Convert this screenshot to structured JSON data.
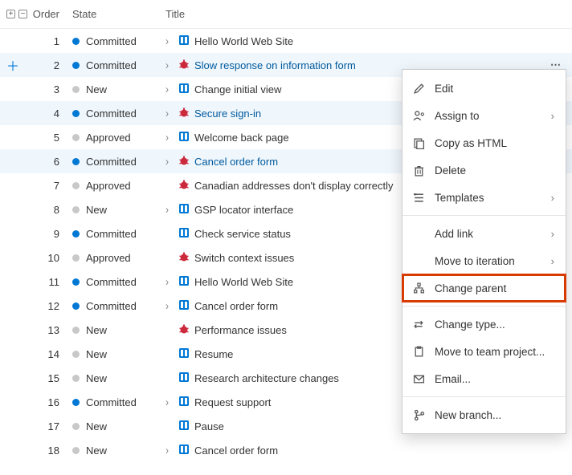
{
  "columns": {
    "order": "Order",
    "state": "State",
    "title": "Title"
  },
  "rows": [
    {
      "order": 1,
      "state": "Committed",
      "dot": "blue",
      "icon": "pbi",
      "chev": true,
      "link": false,
      "title": "Hello World Web Site",
      "sel": false,
      "actions": false,
      "add": false
    },
    {
      "order": 2,
      "state": "Committed",
      "dot": "blue",
      "icon": "bug",
      "chev": true,
      "link": true,
      "title": "Slow response on information form",
      "sel": true,
      "actions": true,
      "add": true
    },
    {
      "order": 3,
      "state": "New",
      "dot": "grey",
      "icon": "pbi",
      "chev": true,
      "link": false,
      "title": "Change initial view",
      "sel": false,
      "actions": false,
      "add": false
    },
    {
      "order": 4,
      "state": "Committed",
      "dot": "blue",
      "icon": "bug",
      "chev": true,
      "link": true,
      "title": "Secure sign-in",
      "sel": true,
      "actions": true,
      "add": false
    },
    {
      "order": 5,
      "state": "Approved",
      "dot": "grey",
      "icon": "pbi",
      "chev": true,
      "link": false,
      "title": "Welcome back page",
      "sel": false,
      "actions": false,
      "add": false
    },
    {
      "order": 6,
      "state": "Committed",
      "dot": "blue",
      "icon": "bug",
      "chev": true,
      "link": true,
      "title": "Cancel order form",
      "sel": true,
      "actions": true,
      "add": false
    },
    {
      "order": 7,
      "state": "Approved",
      "dot": "grey",
      "icon": "bug",
      "chev": false,
      "link": false,
      "title": "Canadian addresses don't display correctly",
      "sel": false,
      "actions": false,
      "add": false
    },
    {
      "order": 8,
      "state": "New",
      "dot": "grey",
      "icon": "pbi",
      "chev": true,
      "link": false,
      "title": "GSP locator interface",
      "sel": false,
      "actions": false,
      "add": false
    },
    {
      "order": 9,
      "state": "Committed",
      "dot": "blue",
      "icon": "pbi",
      "chev": false,
      "link": false,
      "title": "Check service status",
      "sel": false,
      "actions": false,
      "add": false
    },
    {
      "order": 10,
      "state": "Approved",
      "dot": "grey",
      "icon": "bug",
      "chev": false,
      "link": false,
      "title": "Switch context issues",
      "sel": false,
      "actions": false,
      "add": false
    },
    {
      "order": 11,
      "state": "Committed",
      "dot": "blue",
      "icon": "pbi",
      "chev": true,
      "link": false,
      "title": "Hello World Web Site",
      "sel": false,
      "actions": false,
      "add": false
    },
    {
      "order": 12,
      "state": "Committed",
      "dot": "blue",
      "icon": "pbi",
      "chev": true,
      "link": false,
      "title": "Cancel order form",
      "sel": false,
      "actions": false,
      "add": false
    },
    {
      "order": 13,
      "state": "New",
      "dot": "grey",
      "icon": "bug",
      "chev": false,
      "link": false,
      "title": "Performance issues",
      "sel": false,
      "actions": false,
      "add": false
    },
    {
      "order": 14,
      "state": "New",
      "dot": "grey",
      "icon": "pbi",
      "chev": false,
      "link": false,
      "title": "Resume",
      "sel": false,
      "actions": false,
      "add": false
    },
    {
      "order": 15,
      "state": "New",
      "dot": "grey",
      "icon": "pbi",
      "chev": false,
      "link": false,
      "title": "Research architecture changes",
      "sel": false,
      "actions": false,
      "add": false
    },
    {
      "order": 16,
      "state": "Committed",
      "dot": "blue",
      "icon": "pbi",
      "chev": true,
      "link": false,
      "title": "Request support",
      "sel": false,
      "actions": false,
      "add": false
    },
    {
      "order": 17,
      "state": "New",
      "dot": "grey",
      "icon": "pbi",
      "chev": false,
      "link": false,
      "title": "Pause",
      "sel": false,
      "actions": false,
      "add": false
    },
    {
      "order": 18,
      "state": "New",
      "dot": "grey",
      "icon": "pbi",
      "chev": true,
      "link": false,
      "title": "Cancel order form",
      "sel": false,
      "actions": false,
      "add": false
    }
  ],
  "menu": {
    "groups": [
      [
        {
          "key": "edit",
          "label": "Edit",
          "icon": "pencil",
          "sub": false
        },
        {
          "key": "assign",
          "label": "Assign to",
          "icon": "person",
          "sub": true
        },
        {
          "key": "copyhtml",
          "label": "Copy as HTML",
          "icon": "copy",
          "sub": false
        },
        {
          "key": "delete",
          "label": "Delete",
          "icon": "trash",
          "sub": false
        },
        {
          "key": "templates",
          "label": "Templates",
          "icon": "template",
          "sub": true
        }
      ],
      [
        {
          "key": "addlink",
          "label": "Add link",
          "icon": "",
          "sub": true
        },
        {
          "key": "moveiter",
          "label": "Move to iteration",
          "icon": "",
          "sub": true
        },
        {
          "key": "chparent",
          "label": "Change parent",
          "icon": "tree",
          "sub": false,
          "highlight": true
        }
      ],
      [
        {
          "key": "chtype",
          "label": "Change type...",
          "icon": "swap",
          "sub": false
        },
        {
          "key": "moveproj",
          "label": "Move to team project...",
          "icon": "folder",
          "sub": false
        },
        {
          "key": "email",
          "label": "Email...",
          "icon": "mail",
          "sub": false
        }
      ],
      [
        {
          "key": "newbranch",
          "label": "New branch...",
          "icon": "branch",
          "sub": false
        }
      ]
    ]
  }
}
